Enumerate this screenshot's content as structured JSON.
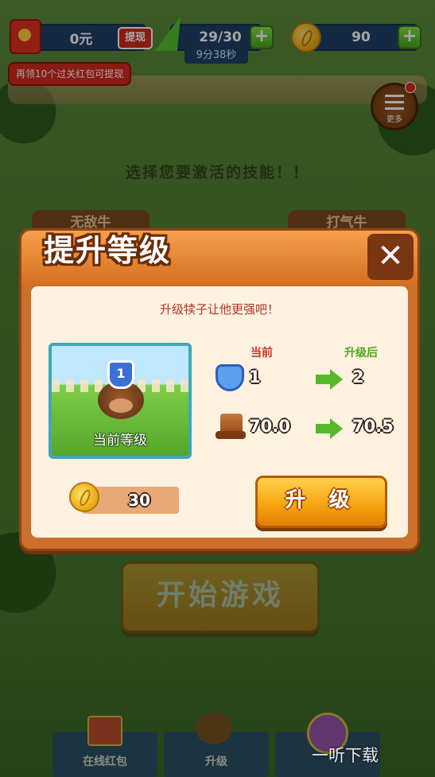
{
  "topbar": {
    "money": "0元",
    "withdraw_label": "提现",
    "energy": "29/30",
    "energy_timer": "9分38秒",
    "coins": "90",
    "red_packet_hint": "再领10个过关红包可提现",
    "more_label": "更多"
  },
  "background": {
    "headline": "选择您要激活的技能！！",
    "skill_tabs": [
      "无敌牛",
      "打气牛"
    ],
    "start_button": "开始游戏"
  },
  "modal": {
    "title": "提升等级",
    "subtitle": "升级犊子让他更强吧！",
    "portrait_label": "当前等级",
    "portrait_level": "1",
    "current_header": "当前",
    "after_header": "升级后",
    "stats": [
      {
        "icon": "level-shield-icon",
        "current": "1",
        "after": "2"
      },
      {
        "icon": "speed-boot-icon",
        "current": "70.0",
        "after": "70.5"
      }
    ],
    "cost": "30",
    "upgrade_button": "升 级",
    "colors": {
      "current_header": "#c0392b",
      "after_header": "#4aa81c",
      "accent": "#f6a10f"
    }
  },
  "bottom_nav": {
    "tabs": [
      "在线红包",
      "升级"
    ]
  },
  "watermark": "一听下载"
}
